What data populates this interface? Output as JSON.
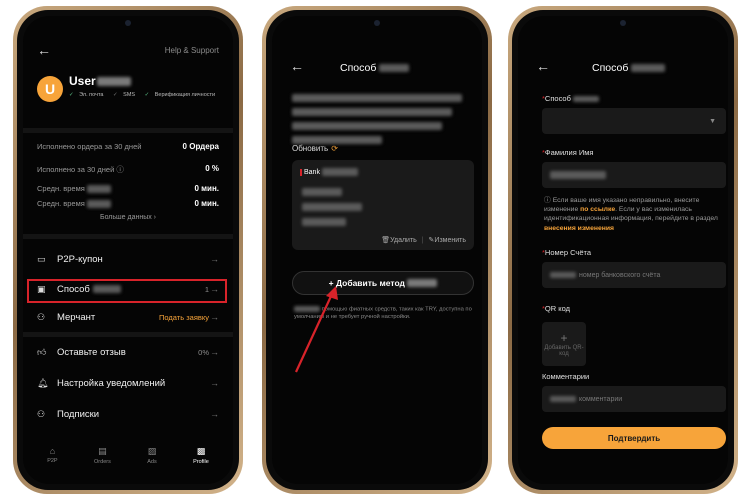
{
  "phone1": {
    "help_link": "Help & Support",
    "avatar_letter": "U",
    "username": "User",
    "verifications": [
      "Эл. почта",
      "SMS",
      "Верификация личности"
    ],
    "stats": [
      {
        "label": "Исполнено ордера за 30 дней",
        "value": "0 Ордера"
      },
      {
        "label": "Исполнено за 30 дней",
        "value": "0 %"
      },
      {
        "label": "Средн. время",
        "value": "0 мин."
      },
      {
        "label": "Средн. время",
        "value": "0 мин."
      }
    ],
    "more_data": "Больше данных",
    "menu": [
      {
        "label": "P2P-купон",
        "right": ""
      },
      {
        "label": "Способ",
        "right": "1"
      },
      {
        "label": "Мерчант",
        "right": "Подать заявку"
      },
      {
        "label": "Оставьте отзыв",
        "right": "0%"
      },
      {
        "label": "Настройка уведомлений",
        "right": ""
      },
      {
        "label": "Подписки",
        "right": ""
      }
    ],
    "tabs": [
      "P2P",
      "Orders",
      "Ads",
      "Profile"
    ]
  },
  "phone2": {
    "title": "Способ",
    "refresh_label": "Обновить",
    "card_bank": "Bank",
    "delete_label": "Удалить",
    "edit_label": "Изменить",
    "add_method_label": "+ Добавить метод",
    "note": "помощью фиатных средств, таких как TRY, доступна по умолчанию и не требует ручной настройки."
  },
  "phone3": {
    "title": "Способ",
    "field_method_label": "Способ",
    "field_name_label": "Фамилия Имя",
    "info_text_1": "Если ваше имя указано неправильно, внесите изменение",
    "info_link_1": "по ссылке",
    "info_text_2": ". Если у вас изменилась идентификационная информация, перейдите в раздел",
    "info_link_2": "внесения изменения",
    "field_account_label": "Номер Счёта",
    "field_account_placeholder": "номер банковского счёта",
    "qr_label": "QR код",
    "qr_box_text": "Добавить QR-код",
    "comments_label": "Комментарии",
    "comments_placeholder": "комментарии",
    "submit_label": "Подтвердить"
  },
  "colors": {
    "accent": "#f7a43a",
    "highlight": "#d8232a",
    "background": "#050505"
  }
}
